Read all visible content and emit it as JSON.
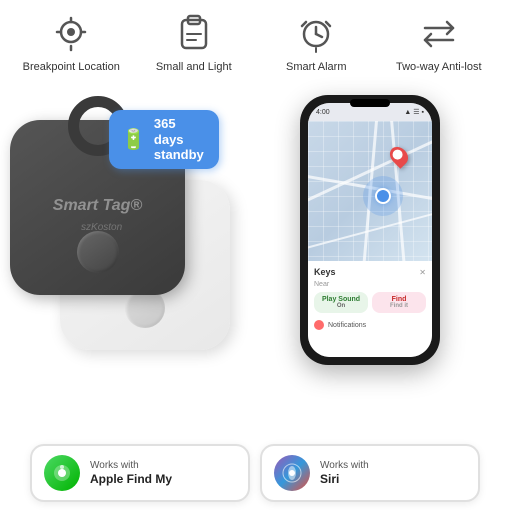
{
  "features": [
    {
      "id": "breakpoint-location",
      "label": "Breakpoint\nLocation",
      "icon": "location"
    },
    {
      "id": "small-light",
      "label": "Small\nand Light",
      "icon": "small"
    },
    {
      "id": "smart-alarm",
      "label": "Smart\nAlarm",
      "icon": "alarm"
    },
    {
      "id": "two-way",
      "label": "Two-way\nAnti-lost",
      "icon": "twoway"
    }
  ],
  "standby": {
    "days": "365 days",
    "label": "standby"
  },
  "tag": {
    "brand": "Smart Tag",
    "trademark": "®",
    "watermark": "szKoston"
  },
  "phone": {
    "status_time": "4:00",
    "map_section": "Keys",
    "buttons": {
      "play_sound": "Play Sound",
      "find": "Find"
    },
    "notifications": "Notifications"
  },
  "badges": [
    {
      "id": "findmy",
      "prefix": "Works with",
      "main": "Apple Find My"
    },
    {
      "id": "siri",
      "prefix": "Works with",
      "main": "Siri"
    }
  ]
}
